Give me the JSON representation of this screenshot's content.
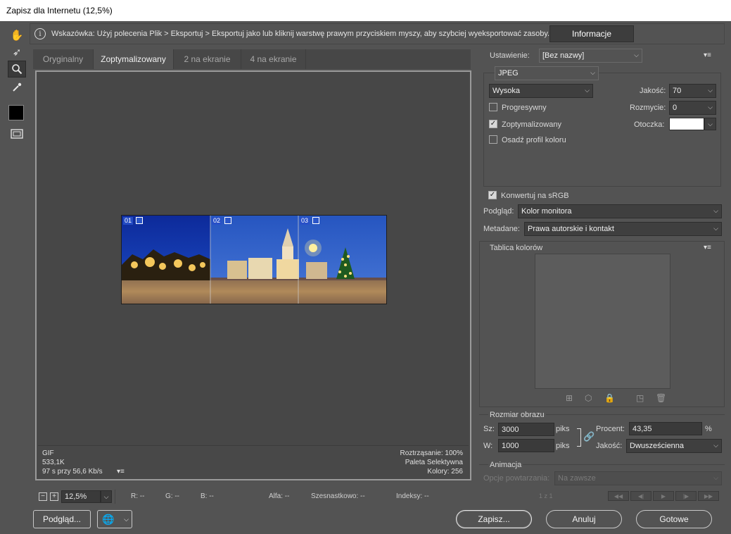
{
  "window": {
    "title": "Zapisz dla Internetu (12,5%)"
  },
  "tools": [
    {
      "name": "hand-tool-icon",
      "glyph": "✋"
    },
    {
      "name": "slice-select-tool-icon",
      "glyph": "➶"
    },
    {
      "name": "zoom-tool-icon",
      "glyph": "🔍"
    },
    {
      "name": "eyedropper-tool-icon",
      "glyph": "✎"
    },
    {
      "name": "toggle-slices-icon",
      "glyph": "▣"
    }
  ],
  "hint": {
    "text": "Wskazówka: Użyj polecenia Plik > Eksportuj > Eksportuj jako lub kliknij warstwę prawym przyciskiem myszy, aby szybciej wyeksportować zasoby.",
    "info_button": "Informacje"
  },
  "tabs": [
    {
      "label": "Oryginalny",
      "active": false
    },
    {
      "label": "Zoptymalizowany",
      "active": true
    },
    {
      "label": "2 na ekranie",
      "active": false
    },
    {
      "label": "4 na ekranie",
      "active": false
    }
  ],
  "slices": [
    "01",
    "02",
    "03"
  ],
  "info_left": {
    "format": "GIF",
    "size": "533,1K",
    "time": "97 s przy 56,6 Kb/s"
  },
  "info_right": {
    "dither": "Roztrząsanie: 100%",
    "palette": "Paleta Selektywna",
    "colors": "Kolory: 256"
  },
  "statusbar": {
    "zoom": "12,5%",
    "r": "R: --",
    "g": "G: --",
    "b": "B: --",
    "alpha": "Alfa: --",
    "hex": "Szesnastkowo: --",
    "index": "Indeksy: --"
  },
  "footer": {
    "preview_button": "Podgląd...",
    "save_button": "Zapisz...",
    "cancel_button": "Anuluj",
    "done_button": "Gotowe"
  },
  "settings": {
    "preset_label": "Ustawienie:",
    "preset_value": "[Bez nazwy]",
    "format_value": "JPEG",
    "quality_preset": "Wysoka",
    "quality_label": "Jakość:",
    "quality_value": "70",
    "blur_label": "Rozmycie:",
    "blur_value": "0",
    "matte_label": "Otoczka:",
    "matte_color": "#ffffff",
    "progressive_label": "Progresywny",
    "progressive_checked": false,
    "optimized_label": "Zoptymalizowany",
    "optimized_checked": true,
    "embed_profile_label": "Osadź profil koloru",
    "embed_profile_checked": false,
    "convert_srgb_label": "Konwertuj na sRGB",
    "convert_srgb_checked": true,
    "preview_label": "Podgląd:",
    "preview_value": "Kolor monitora",
    "metadata_label": "Metadane:",
    "metadata_value": "Prawa autorskie i kontakt"
  },
  "color_table": {
    "title": "Tablica kolorów"
  },
  "image_size": {
    "title": "Rozmiar obrazu",
    "width_label": "Sz:",
    "width_value": "3000",
    "height_label": "W:",
    "height_value": "1000",
    "unit": "piks",
    "percent_label": "Procent:",
    "percent_value": "43,35",
    "percent_unit": "%",
    "quality_label": "Jakość:",
    "quality_value": "Dwusześcienna"
  },
  "animation": {
    "title": "Animacja",
    "loop_label": "Opcje powtarzania:",
    "loop_value": "Na zawsze",
    "frame_counter": "1 z 1"
  }
}
